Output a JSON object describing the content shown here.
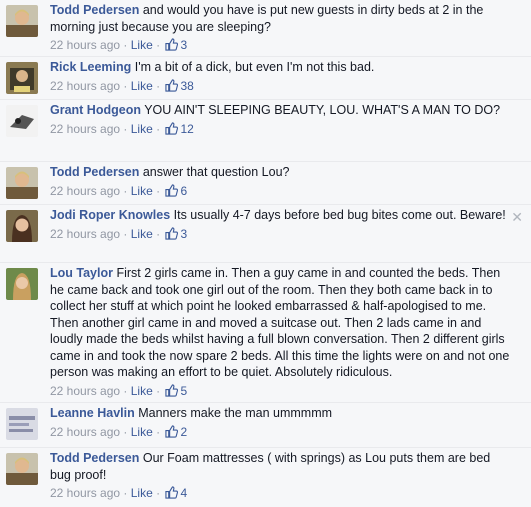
{
  "comments": [
    {
      "author": "Todd Pedersen",
      "text": "and would you have is put new guests in dirty beds at 2 in the morning just because you are sleeping?",
      "time": "22 hours ago",
      "like": "Like",
      "likes": "3"
    },
    {
      "author": "Rick Leeming",
      "text": "I'm a bit of a dick, but even I'm not this bad.",
      "time": "22 hours ago",
      "like": "Like",
      "likes": "38"
    },
    {
      "author": "Grant Hodgeon",
      "text": "YOU AIN'T SLEEPING BEAUTY, LOU. WHAT'S A MAN TO DO?",
      "time": "22 hours ago",
      "like": "Like",
      "likes": "12"
    },
    {
      "author": "Todd Pedersen",
      "text": "answer that question Lou?",
      "time": "22 hours ago",
      "like": "Like",
      "likes": "6"
    },
    {
      "author": "Jodi Roper Knowles",
      "text": "Its usually 4-7 days before bed bug bites come out. Beware!",
      "time": "22 hours ago",
      "like": "Like",
      "likes": "3",
      "close": "✕"
    },
    {
      "author": "Lou Taylor",
      "text": "First 2 girls came in. Then a guy came in and counted the beds. Then he came back and took one girl out of the room. Then they both came back in to collect her stuff at which point he looked embarrassed & half-apologised to me. Then another girl came in and moved a suitcase out. Then 2 lads came in and loudly made the beds whilst having a full blown conversation. Then 2 different girls came in and took the now spare 2 beds. All this time the lights were on and not one person was making an effort to be quiet. Absolutely ridiculous.",
      "time": "22 hours ago",
      "like": "Like",
      "likes": "5"
    },
    {
      "author": "Leanne Havlin",
      "text": "Manners make the man ummmmm",
      "time": "22 hours ago",
      "like": "Like",
      "likes": "2"
    },
    {
      "author": "Todd Pedersen",
      "text": "Our Foam mattresses ( with springs) as Lou puts them are bed bug proof!",
      "time": "22 hours ago",
      "like": "Like",
      "likes": "4"
    }
  ],
  "separator": "·",
  "icons": {
    "like": "thumbs-up-icon",
    "close": "close-icon"
  },
  "colors": {
    "link": "#3b5998",
    "meta": "#9197a3",
    "background": "#f6f7f9"
  }
}
